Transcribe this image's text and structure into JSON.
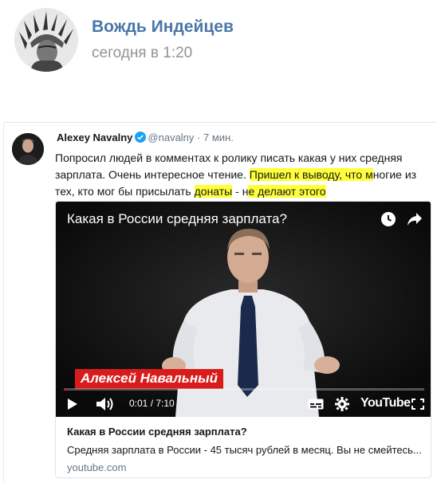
{
  "post": {
    "author": "Вождь Индейцев",
    "time": "сегодня в 1:20"
  },
  "tweet": {
    "name": "Alexey Navalny",
    "handle": "@navalny",
    "separator": "·",
    "time": "7 мин.",
    "text_parts": [
      "Попросил людей в комментах к ролику писать какая у них средняя зарплата. Очень интересное чтение. ",
      "Пришел к выводу, что м",
      "ногие из тех, кто мог бы присылать ",
      "донаты",
      " - н",
      "е делают этого"
    ],
    "highlight_color": "#ffff3a"
  },
  "video": {
    "overlay_title": "Какая в России средняя зарплата?",
    "lower_third": "Алексей Навальный",
    "time_display": "0:01 / 7:10",
    "brand": "YouTube",
    "progress_fraction": 0.002,
    "icons": [
      "clock-icon",
      "share-icon",
      "play-icon",
      "volume-icon",
      "subtitles-icon",
      "gear-icon",
      "fullscreen-icon"
    ]
  },
  "card": {
    "title": "Какая в России средняя зарплата?",
    "description": "Средняя зарплата в России - 45 тысяч рублей в месяц. Вы не смейтесь...",
    "domain": "youtube.com"
  },
  "colors": {
    "vk_link": "#4a76a8",
    "muted": "#939393",
    "twitter_blue": "#1da1f2",
    "lower_third_red": "#d81c1c"
  }
}
